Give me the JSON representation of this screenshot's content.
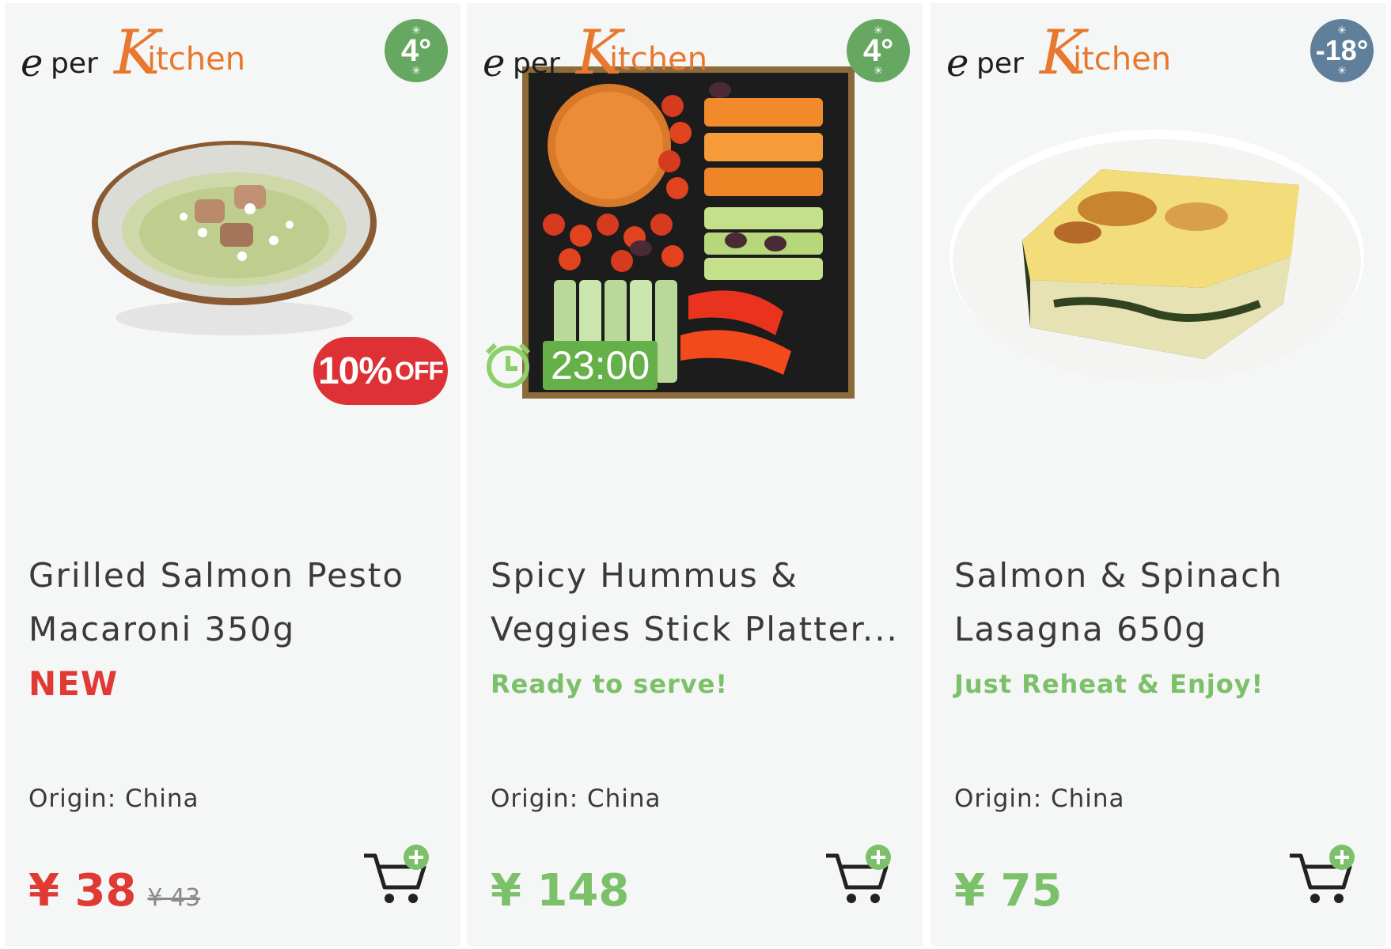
{
  "brand": {
    "e": "e",
    "per": "per",
    "k": "K",
    "itchen": "itchen"
  },
  "products": [
    {
      "temperature": "4°",
      "badge": "10%",
      "badge_suffix": "OFF",
      "title_line1": "Grilled Salmon Pesto",
      "title_line2": "Macaroni 350g",
      "tag": "NEW",
      "origin": "Origin: China",
      "price": "¥ 38",
      "old_price": "¥ 43"
    },
    {
      "temperature": "4°",
      "timer": "23:00",
      "title_line1": "Spicy Hummus &",
      "title_line2": "Veggies Stick Platter...",
      "tag": "Ready to serve!",
      "origin": "Origin: China",
      "price": "¥ 148"
    },
    {
      "temperature": "-18°",
      "title_line1": "Salmon & Spinach",
      "title_line2": "Lasagna 650g",
      "tag": "Just Reheat & Enjoy!",
      "origin": "Origin: China",
      "price": "¥ 75"
    }
  ],
  "colors": {
    "brand_orange": "#e8782f",
    "sale_red": "#e03a35",
    "fresh_green": "#7cc06a",
    "frozen_blue": "#5f7f9b"
  }
}
